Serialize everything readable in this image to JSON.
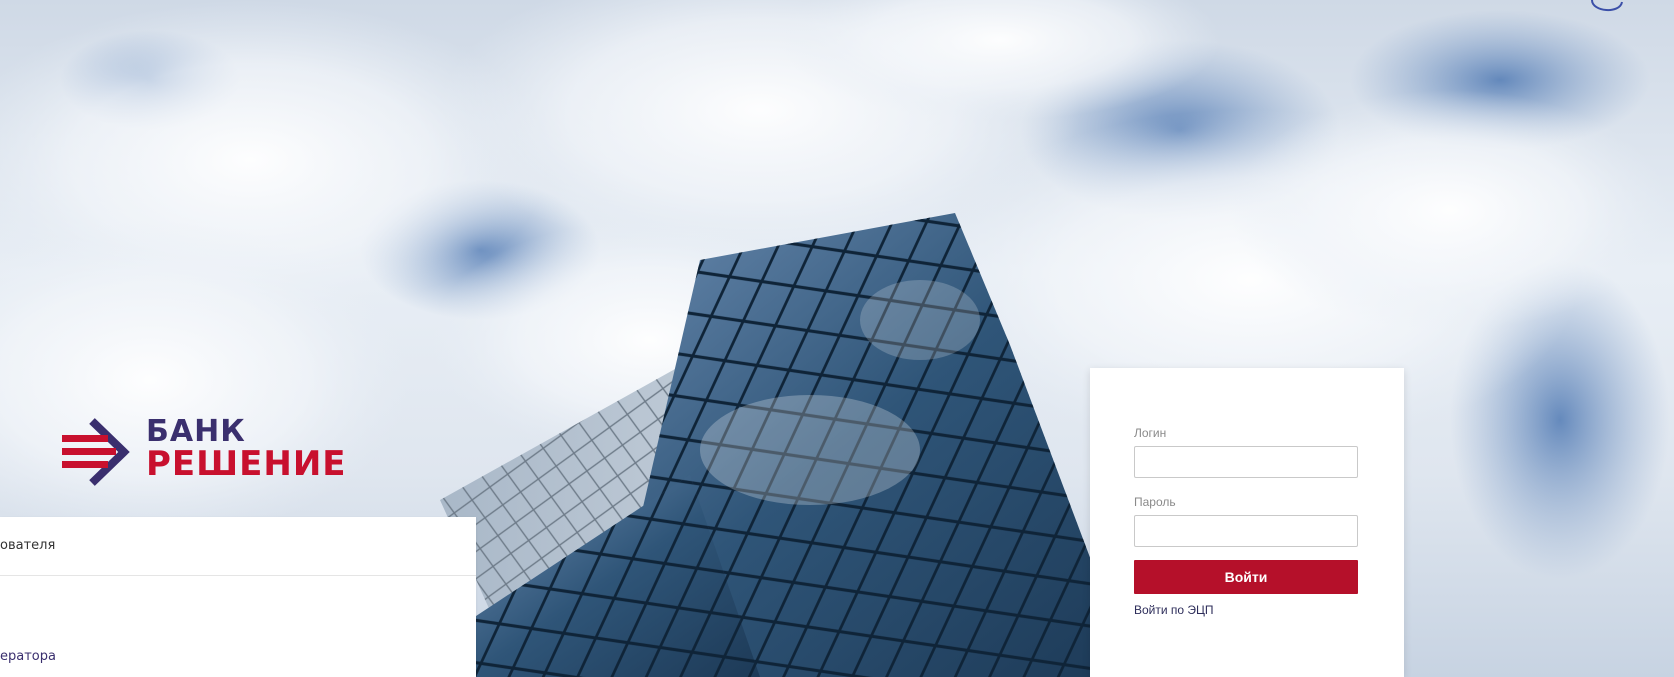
{
  "brand": {
    "name_line1": "БАНК",
    "name_line2": "РЕШЕНИЕ",
    "colors": {
      "primary_red": "#c8102e",
      "primary_purple": "#3a2f6e"
    },
    "logo_icon": "arrow-stripes-logo-icon"
  },
  "left_panel": {
    "row1_text": "ователя",
    "row2_text": "ератора"
  },
  "login_form": {
    "login_label": "Логин",
    "login_value": "",
    "password_label": "Пароль",
    "password_value": "",
    "submit_label": "Войти",
    "ecp_link": "Войти по ЭЦП",
    "button_color": "#b5102a"
  }
}
